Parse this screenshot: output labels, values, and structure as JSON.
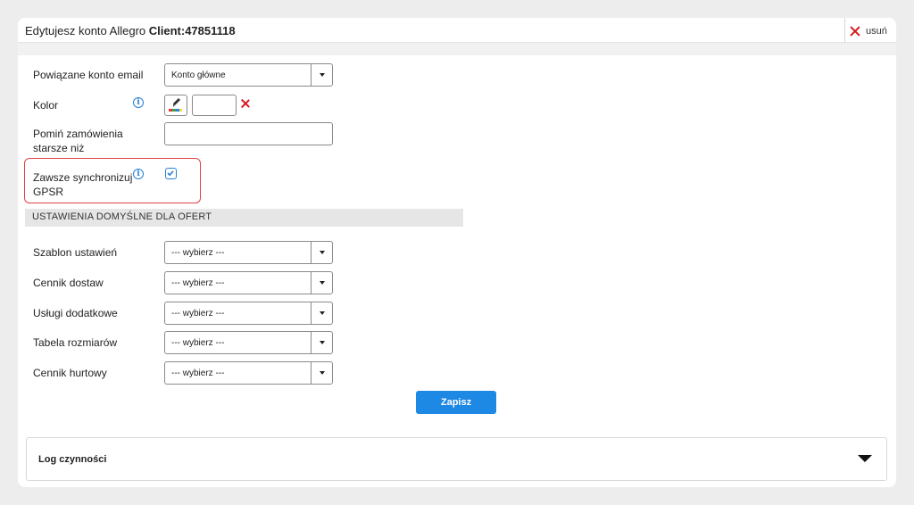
{
  "header": {
    "title_prefix": "Edytujesz konto Allegro",
    "title_client": "Client:47851118",
    "delete_label": "usuń"
  },
  "form": {
    "email_account": {
      "label": "Powiązane konto email",
      "value": "Konto główne"
    },
    "color": {
      "label": "Kolor",
      "value": ""
    },
    "skip_orders": {
      "label_line1": "Pomiń zamówienia",
      "label_line2": "starsze niż",
      "value": ""
    },
    "sync_gpsr": {
      "label_line1": "Zawsze synchronizuj",
      "label_line2": "GPSR",
      "checked": true
    }
  },
  "section": {
    "title": "USTAWIENIA DOMYŚLNE DLA OFERT"
  },
  "defaults": [
    {
      "label": "Szablon ustawień",
      "value": "--- wybierz ---"
    },
    {
      "label": "Cennik dostaw",
      "value": "--- wybierz ---"
    },
    {
      "label": "Usługi dodatkowe",
      "value": "--- wybierz ---"
    },
    {
      "label": "Tabela rozmiarów",
      "value": "--- wybierz ---"
    },
    {
      "label": "Cennik hurtowy",
      "value": "--- wybierz ---"
    }
  ],
  "actions": {
    "save_label": "Zapisz"
  },
  "log": {
    "title": "Log czynności"
  },
  "colors": {
    "accent": "#1e88e5",
    "danger": "#d9161c",
    "highlight": "#e34141",
    "background": "#ededed"
  },
  "icons": {
    "delete": "close-icon",
    "info": "info-icon",
    "color_picker": "paint-bucket-icon",
    "dropdown": "caret-down-icon",
    "log_toggle": "triangle-down-icon"
  }
}
